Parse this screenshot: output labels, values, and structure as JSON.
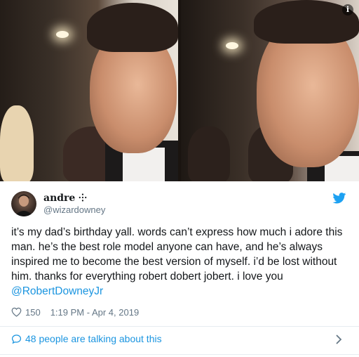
{
  "tweet": {
    "display_name": "andre ⸭",
    "handle": "@wizardowney",
    "text": "it’s my dad’s birthday yall. words can’t express how much i adore this man. he’s the best role model anyone can have, and he’s always inspired me to become the best version of myself. i’d be lost without him. thanks for everything robert dobert jobert. i love you",
    "mention": "@RobertDowneyJr",
    "like_count": "150",
    "timestamp": "1:19 PM - Apr 4, 2019",
    "talking_label": "48 people are talking about this"
  },
  "media": {
    "info_label": "i"
  },
  "icons": {
    "brand": "twitter-bird-icon",
    "like": "heart-icon",
    "talk": "speech-bubble-icon",
    "chevron": "chevron-right-icon"
  },
  "colors": {
    "link": "#1b95e0",
    "secondary_text": "#657786",
    "text": "#14171a",
    "divider": "#e6ecf0"
  }
}
